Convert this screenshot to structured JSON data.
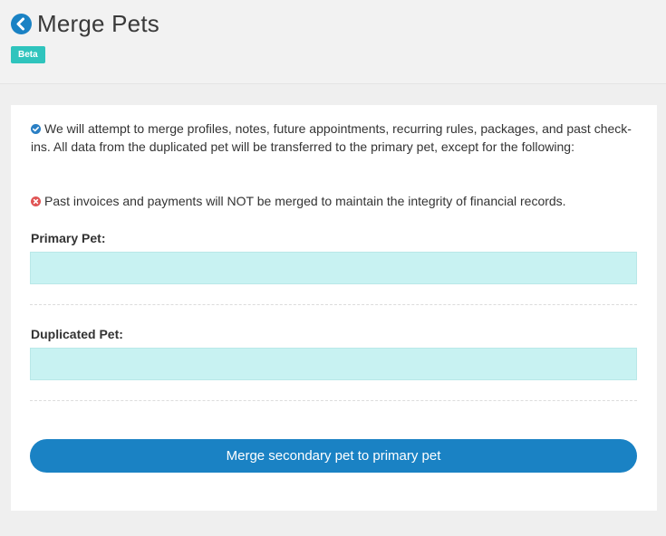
{
  "header": {
    "title": "Merge Pets",
    "back_icon": "chevron-left-circle-icon",
    "badge": "Beta",
    "badge_color": "#2fc4bd"
  },
  "info": {
    "merge_note": "We will attempt to merge profiles, notes, future appointments, recurring rules, packages, and past check-ins. All data from the duplicated pet will be transferred to the primary pet, except for the following:",
    "merge_note_icon": "check-circle-icon",
    "exception_note": "Past invoices and payments will NOT be merged to maintain the integrity of financial records.",
    "exception_note_icon": "x-circle-icon"
  },
  "form": {
    "primary_label": "Primary Pet:",
    "primary_value": "",
    "duplicated_label": "Duplicated Pet:",
    "duplicated_value": ""
  },
  "actions": {
    "merge_label": "Merge secondary pet to primary pet",
    "button_color": "#1a82c4"
  },
  "colors": {
    "input_bg": "#c8f2f2",
    "check_icon": "#2a7fc4",
    "x_icon": "#e05555"
  }
}
